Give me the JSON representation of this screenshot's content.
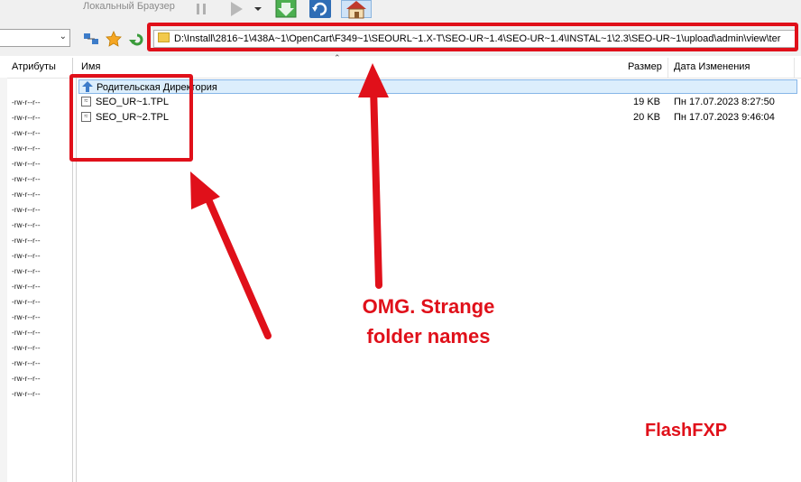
{
  "toolbar": {
    "local_browser_label": "Локальный Браузер",
    "icons": [
      "pause-icon",
      "play-icon",
      "dropdown-arrow-icon",
      "transfer-download-icon",
      "refresh-icon",
      "home-icon"
    ]
  },
  "path_bar": {
    "icons": [
      "network-icon",
      "favorites-star-icon",
      "back-arrow-icon",
      "folder-icon"
    ],
    "path": "D:\\Install\\2816~1\\438A~1\\OpenCart\\F349~1\\SEOURL~1.X-T\\SEO-UR~1.4\\SEO-UR~1.4\\INSTAL~1\\2.3\\SEO-UR~1\\upload\\admin\\view\\ter"
  },
  "left_pane": {
    "column_header": "Атрибуты",
    "attributes": [
      "-rw-r--r--",
      "-rw-r--r--",
      "-rw-r--r--",
      "-rw-r--r--",
      "-rw-r--r--",
      "-rw-r--r--",
      "-rw-r--r--",
      "-rw-r--r--",
      "-rw-r--r--",
      "-rw-r--r--",
      "-rw-r--r--",
      "-rw-r--r--",
      "-rw-r--r--",
      "-rw-r--r--",
      "-rw-r--r--",
      "-rw-r--r--",
      "-rw-r--r--",
      "-rw-r--r--",
      "-rw-r--r--",
      "-rw-r--r--"
    ]
  },
  "file_list": {
    "headers": {
      "name": "Имя",
      "size": "Размер",
      "date": "Дата Изменения"
    },
    "parent_label": "Родительская Директория",
    "files": [
      {
        "name": "SEO_UR~1.TPL",
        "size": "19 KB",
        "date": "Пн 17.07.2023 8:27:50"
      },
      {
        "name": "SEO_UR~2.TPL",
        "size": "20 KB",
        "date": "Пн 17.07.2023 9:46:04"
      }
    ]
  },
  "annotations": {
    "callout_line1": "OMG. Strange",
    "callout_line2": "folder names",
    "brand": "FlashFXP",
    "accent_color": "#e0101a"
  }
}
